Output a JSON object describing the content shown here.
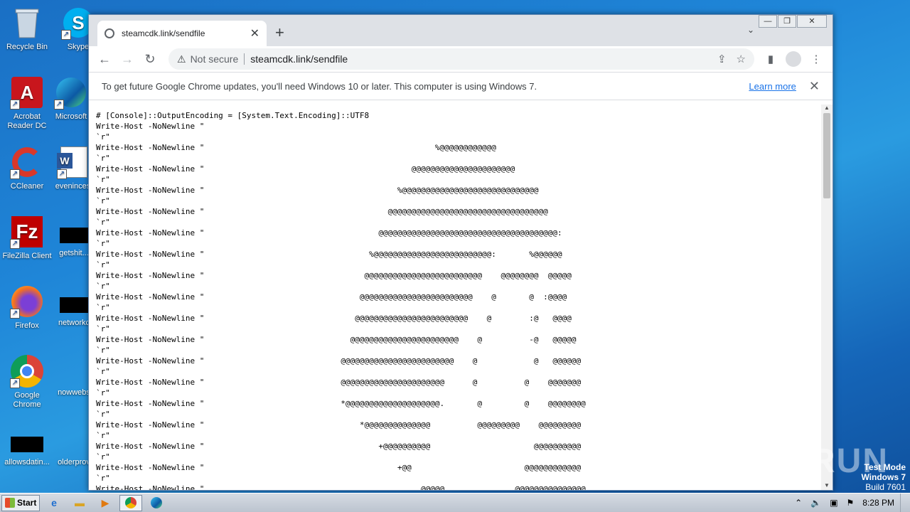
{
  "desktop": {
    "icons": [
      {
        "label": "Recycle Bin",
        "icon": "recycle-bin-icon"
      },
      {
        "label": "Acrobat Reader DC",
        "icon": "acrobat-icon"
      },
      {
        "label": "CCleaner",
        "icon": "ccleaner-icon"
      },
      {
        "label": "FileZilla Client",
        "icon": "filezilla-icon"
      },
      {
        "label": "Firefox",
        "icon": "firefox-icon"
      },
      {
        "label": "Google Chrome",
        "icon": "chrome-icon"
      },
      {
        "label": "allowsdatin...",
        "icon": "file-icon"
      },
      {
        "label": "Skype",
        "icon": "skype-icon"
      },
      {
        "label": "Microsoft",
        "icon": "edge-icon"
      },
      {
        "label": "evenincest",
        "icon": "word-icon"
      },
      {
        "label": "getshit...",
        "icon": "file-icon"
      },
      {
        "label": "networkc",
        "icon": "file-icon"
      },
      {
        "label": "nowwebs",
        "icon": "file-icon"
      },
      {
        "label": "olderprov",
        "icon": "file-icon"
      }
    ],
    "watermark": "ANY RUN",
    "test_mode": {
      "line1": "Test Mode",
      "line2": "Windows 7",
      "line3": "Build 7601"
    }
  },
  "browser": {
    "tab_title": "steamcdk.link/sendfile",
    "window_controls": {
      "minimize": "—",
      "restore": "❐",
      "close": "✕"
    },
    "security_label": "Not secure",
    "url": "steamcdk.link/sendfile",
    "infobar": {
      "message": "To get future Google Chrome updates, you'll need Windows 10 or later. This computer is using Windows 7.",
      "link": "Learn more"
    },
    "page_text": "# [Console]::OutputEncoding = [System.Text.Encoding]::UTF8\nWrite-Host -NoNewline \"\n`r\"\nWrite-Host -NoNewline \"                                                 %@@@@@@@@@@@@\n`r\"\nWrite-Host -NoNewline \"                                            @@@@@@@@@@@@@@@@@@@@@@\n`r\"\nWrite-Host -NoNewline \"                                         %@@@@@@@@@@@@@@@@@@@@@@@@@@@@@\n`r\"\nWrite-Host -NoNewline \"                                       @@@@@@@@@@@@@@@@@@@@@@@@@@@@@@@@@@\n`r\"\nWrite-Host -NoNewline \"                                     @@@@@@@@@@@@@@@@@@@@@@@@@@@@@@@@@@@@@@:\n`r\"\nWrite-Host -NoNewline \"                                   %@@@@@@@@@@@@@@@@@@@@@@@@@:       %@@@@@@\n`r\"\nWrite-Host -NoNewline \"                                  @@@@@@@@@@@@@@@@@@@@@@@@@    @@@@@@@@  @@@@@\n`r\"\nWrite-Host -NoNewline \"                                 @@@@@@@@@@@@@@@@@@@@@@@@    @       @  :@@@@\n`r\"\nWrite-Host -NoNewline \"                                @@@@@@@@@@@@@@@@@@@@@@@@    @        :@   @@@@\n`r\"\nWrite-Host -NoNewline \"                               @@@@@@@@@@@@@@@@@@@@@@@    @          -@   @@@@@\n`r\"\nWrite-Host -NoNewline \"                             @@@@@@@@@@@@@@@@@@@@@@@@    @            @   @@@@@@\n`r\"\nWrite-Host -NoNewline \"                             @@@@@@@@@@@@@@@@@@@@@@      @          @    @@@@@@@\n`r\"\nWrite-Host -NoNewline \"                             *@@@@@@@@@@@@@@@@@@@@.       @         @    @@@@@@@@\n`r\"\nWrite-Host -NoNewline \"                                 *@@@@@@@@@@@@@@          @@@@@@@@@    @@@@@@@@@\n`r\"\nWrite-Host -NoNewline \"                                     +@@@@@@@@@@                      @@@@@@@@@@\n`r\"\nWrite-Host -NoNewline \"                                         +@@                        @@@@@@@@@@@@\n`r\"\nWrite-Host -NoNewline \"                                              @@@@@               @@@@@@@@@@@@@@@"
  },
  "taskbar": {
    "start_label": "Start",
    "clock": "8:28 PM"
  }
}
